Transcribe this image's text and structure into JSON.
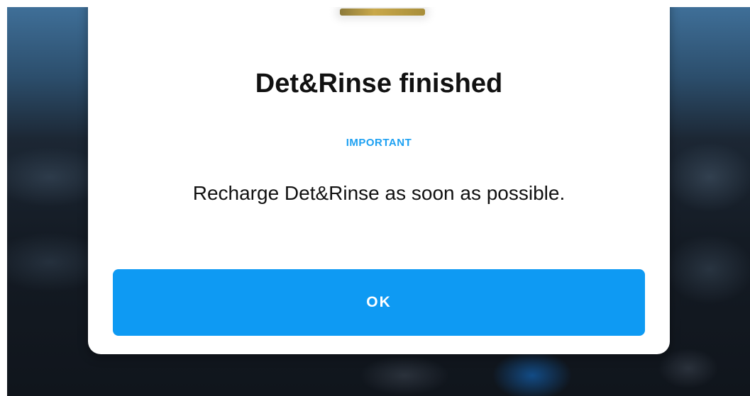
{
  "dialog": {
    "image_icon": "product-image",
    "title": "Det&Rinse finished",
    "label": "IMPORTANT",
    "message": "Recharge Det&Rinse as soon as possible.",
    "ok_label": "OK"
  },
  "colors": {
    "accent": "#0e9af3",
    "label": "#1ea1f2",
    "dialog_background": "#ffffff",
    "text": "#111111"
  }
}
